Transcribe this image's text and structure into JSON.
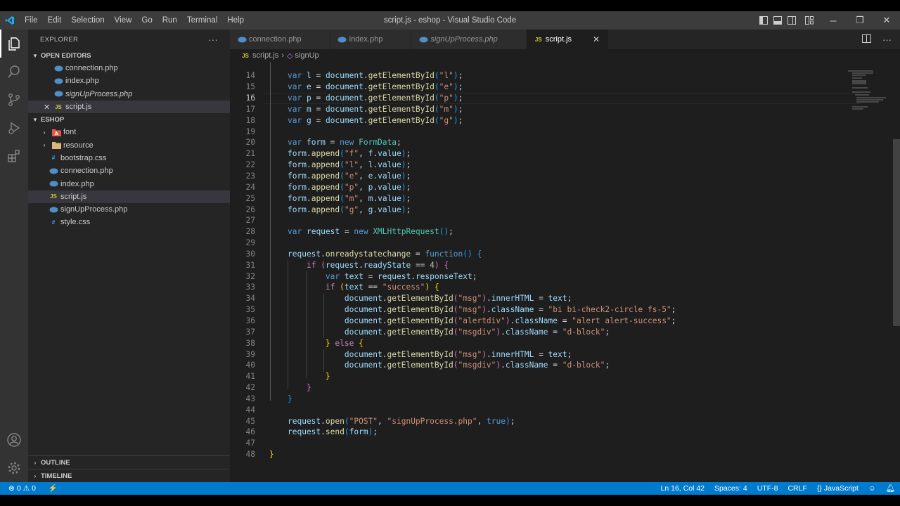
{
  "window": {
    "title": "script.js - eshop - Visual Studio Code",
    "menu": [
      "File",
      "Edit",
      "Selection",
      "View",
      "Go",
      "Run",
      "Terminal",
      "Help"
    ],
    "controls": {
      "minimize": "─",
      "maximize": "❐",
      "close": "✕"
    }
  },
  "activity_bar": {
    "items": [
      "files-icon",
      "search-icon",
      "source-control-icon",
      "run-debug-icon",
      "extensions-icon"
    ],
    "bottom": [
      "account-icon",
      "settings-gear-icon"
    ]
  },
  "sidebar": {
    "header": "EXPLORER",
    "more": "···",
    "open_editors": {
      "title": "OPEN EDITORS",
      "items": [
        {
          "name": "connection.php",
          "italic": false
        },
        {
          "name": "index.php",
          "italic": false
        },
        {
          "name": "signUpProcess.php",
          "italic": true
        },
        {
          "name": "script.js",
          "italic": false,
          "close": "✕"
        }
      ]
    },
    "workspace": {
      "title": "ESHOP",
      "folders": [
        "font",
        "resource"
      ],
      "files": [
        "bootstrap.css",
        "connection.php",
        "index.php",
        "script.js",
        "signUpProcess.php",
        "style.css"
      ]
    },
    "outline": "OUTLINE",
    "timeline": "TIMELINE"
  },
  "tabs": [
    {
      "name": "connection.php",
      "italic": false
    },
    {
      "name": "index.php",
      "italic": false
    },
    {
      "name": "signUpProcess.php",
      "italic": true
    },
    {
      "name": "script.js",
      "italic": false,
      "close": "✕"
    }
  ],
  "breadcrumb": {
    "file": "script.js",
    "symbol": "signUp"
  },
  "editor": {
    "first_line": 14,
    "current_line": 16,
    "line_numbers": [
      "14",
      "15",
      "16",
      "17",
      "18",
      "19",
      "20",
      "21",
      "22",
      "23",
      "24",
      "25",
      "26",
      "27",
      "28",
      "29",
      "30",
      "31",
      "32",
      "33",
      "34",
      "35",
      "36",
      "37",
      "38",
      "39",
      "40",
      "41",
      "42",
      "43",
      "44",
      "45",
      "46",
      "47",
      "48"
    ]
  },
  "statusbar": {
    "errors": "0",
    "warnings": "0",
    "position": "Ln 16, Col 42",
    "spaces": "Spaces: 4",
    "encoding": "UTF-8",
    "eol": "CRLF",
    "language": "JavaScript"
  },
  "colors": {
    "statusbar": "#007acc",
    "activitybar": "#333333",
    "sidebar": "#252526",
    "editor": "#1e1e1e"
  }
}
